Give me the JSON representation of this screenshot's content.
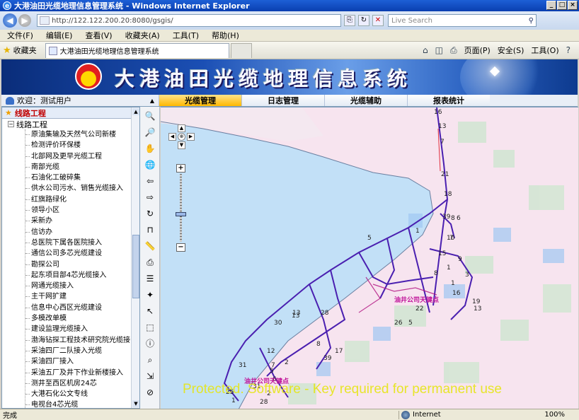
{
  "window": {
    "title": "大港油田光缆地理信息管理系统 - Windows Internet Explorer",
    "url": "http://122.122.200.20:8080/gsgis/",
    "search_placeholder": "Live Search"
  },
  "menu": [
    "文件(F)",
    "编辑(E)",
    "查看(V)",
    "收藏夹(A)",
    "工具(T)",
    "帮助(H)"
  ],
  "favorites": {
    "label": "收藏夹",
    "tab_title": "大港油田光缆地理信息管理系统"
  },
  "command_bar": [
    "页面(P)",
    "安全(S)",
    "工具(O)"
  ],
  "banner": {
    "title": "大港油田光缆地理信息系统"
  },
  "user": {
    "welcome": "欢迎：测试用户"
  },
  "nav_tabs": [
    {
      "label": "光缆管理",
      "active": true
    },
    {
      "label": "日志管理",
      "active": false
    },
    {
      "label": "光缆辅助",
      "active": false
    },
    {
      "label": "报表统计",
      "active": false
    }
  ],
  "sidebar": {
    "header": "线路工程",
    "root": "线路工程",
    "items": [
      "原油集输及天然气公司新楼",
      "检测评价环保楼",
      "北部网及更早光缆工程",
      "南部光缆",
      "石油化工破碎集",
      "供水公司污水、销售光缆接入",
      "红旗路绿化",
      "领导小区",
      "采新办",
      "信访办",
      "总医院下属各医院接入",
      "通信公司多芯光缆建设",
      "勘探公司",
      "起东项目部4芯光缆接入",
      "网通光缆接入",
      "主干网扩建",
      "信息中心西区光缆建设",
      "多模改单模",
      "建设监理光缆接入",
      "渤海钻探工程技术研究院光缆接",
      "采油四厂二队接入光缆",
      "采油四厂接入",
      "采油五厂及井下作业新楼接入",
      "测井至西区机房24芯",
      "大港石化公文专线",
      "电视台4芯光缆"
    ]
  },
  "map": {
    "watermark": "Protected. Software - Key required for permanent use",
    "labels": [
      "油井公司天键点",
      "油井公司天键点"
    ],
    "node_numbers": [
      "16",
      "13",
      "7",
      "21",
      "18",
      "39",
      "8",
      "6",
      "1",
      "10",
      "7",
      "15",
      "9",
      "1",
      "8",
      "3",
      "1",
      "16",
      "19",
      "13",
      "5",
      "26",
      "22",
      "28",
      "13",
      "30",
      "8",
      "17",
      "12",
      "7",
      "5",
      "2",
      "39",
      "6",
      "31",
      "31",
      "28",
      "25",
      "1",
      "2",
      "13",
      "5"
    ]
  },
  "status": {
    "left": "完成",
    "zone": "Internet",
    "zoom": "100%"
  }
}
